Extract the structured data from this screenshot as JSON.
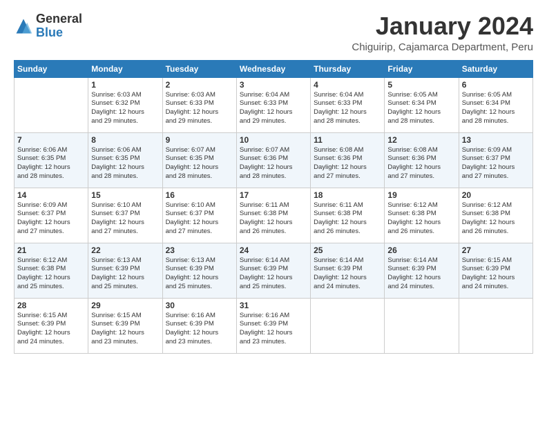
{
  "logo": {
    "general": "General",
    "blue": "Blue"
  },
  "title": "January 2024",
  "location": "Chiguirip, Cajamarca Department, Peru",
  "days_of_week": [
    "Sunday",
    "Monday",
    "Tuesday",
    "Wednesday",
    "Thursday",
    "Friday",
    "Saturday"
  ],
  "weeks": [
    [
      {
        "day": "",
        "info": ""
      },
      {
        "day": "1",
        "info": "Sunrise: 6:03 AM\nSunset: 6:32 PM\nDaylight: 12 hours\nand 29 minutes."
      },
      {
        "day": "2",
        "info": "Sunrise: 6:03 AM\nSunset: 6:33 PM\nDaylight: 12 hours\nand 29 minutes."
      },
      {
        "day": "3",
        "info": "Sunrise: 6:04 AM\nSunset: 6:33 PM\nDaylight: 12 hours\nand 29 minutes."
      },
      {
        "day": "4",
        "info": "Sunrise: 6:04 AM\nSunset: 6:33 PM\nDaylight: 12 hours\nand 28 minutes."
      },
      {
        "day": "5",
        "info": "Sunrise: 6:05 AM\nSunset: 6:34 PM\nDaylight: 12 hours\nand 28 minutes."
      },
      {
        "day": "6",
        "info": "Sunrise: 6:05 AM\nSunset: 6:34 PM\nDaylight: 12 hours\nand 28 minutes."
      }
    ],
    [
      {
        "day": "7",
        "info": "Sunrise: 6:06 AM\nSunset: 6:35 PM\nDaylight: 12 hours\nand 28 minutes."
      },
      {
        "day": "8",
        "info": "Sunrise: 6:06 AM\nSunset: 6:35 PM\nDaylight: 12 hours\nand 28 minutes."
      },
      {
        "day": "9",
        "info": "Sunrise: 6:07 AM\nSunset: 6:35 PM\nDaylight: 12 hours\nand 28 minutes."
      },
      {
        "day": "10",
        "info": "Sunrise: 6:07 AM\nSunset: 6:36 PM\nDaylight: 12 hours\nand 28 minutes."
      },
      {
        "day": "11",
        "info": "Sunrise: 6:08 AM\nSunset: 6:36 PM\nDaylight: 12 hours\nand 27 minutes."
      },
      {
        "day": "12",
        "info": "Sunrise: 6:08 AM\nSunset: 6:36 PM\nDaylight: 12 hours\nand 27 minutes."
      },
      {
        "day": "13",
        "info": "Sunrise: 6:09 AM\nSunset: 6:37 PM\nDaylight: 12 hours\nand 27 minutes."
      }
    ],
    [
      {
        "day": "14",
        "info": "Sunrise: 6:09 AM\nSunset: 6:37 PM\nDaylight: 12 hours\nand 27 minutes."
      },
      {
        "day": "15",
        "info": "Sunrise: 6:10 AM\nSunset: 6:37 PM\nDaylight: 12 hours\nand 27 minutes."
      },
      {
        "day": "16",
        "info": "Sunrise: 6:10 AM\nSunset: 6:37 PM\nDaylight: 12 hours\nand 27 minutes."
      },
      {
        "day": "17",
        "info": "Sunrise: 6:11 AM\nSunset: 6:38 PM\nDaylight: 12 hours\nand 26 minutes."
      },
      {
        "day": "18",
        "info": "Sunrise: 6:11 AM\nSunset: 6:38 PM\nDaylight: 12 hours\nand 26 minutes."
      },
      {
        "day": "19",
        "info": "Sunrise: 6:12 AM\nSunset: 6:38 PM\nDaylight: 12 hours\nand 26 minutes."
      },
      {
        "day": "20",
        "info": "Sunrise: 6:12 AM\nSunset: 6:38 PM\nDaylight: 12 hours\nand 26 minutes."
      }
    ],
    [
      {
        "day": "21",
        "info": "Sunrise: 6:12 AM\nSunset: 6:38 PM\nDaylight: 12 hours\nand 25 minutes."
      },
      {
        "day": "22",
        "info": "Sunrise: 6:13 AM\nSunset: 6:39 PM\nDaylight: 12 hours\nand 25 minutes."
      },
      {
        "day": "23",
        "info": "Sunrise: 6:13 AM\nSunset: 6:39 PM\nDaylight: 12 hours\nand 25 minutes."
      },
      {
        "day": "24",
        "info": "Sunrise: 6:14 AM\nSunset: 6:39 PM\nDaylight: 12 hours\nand 25 minutes."
      },
      {
        "day": "25",
        "info": "Sunrise: 6:14 AM\nSunset: 6:39 PM\nDaylight: 12 hours\nand 24 minutes."
      },
      {
        "day": "26",
        "info": "Sunrise: 6:14 AM\nSunset: 6:39 PM\nDaylight: 12 hours\nand 24 minutes."
      },
      {
        "day": "27",
        "info": "Sunrise: 6:15 AM\nSunset: 6:39 PM\nDaylight: 12 hours\nand 24 minutes."
      }
    ],
    [
      {
        "day": "28",
        "info": "Sunrise: 6:15 AM\nSunset: 6:39 PM\nDaylight: 12 hours\nand 24 minutes."
      },
      {
        "day": "29",
        "info": "Sunrise: 6:15 AM\nSunset: 6:39 PM\nDaylight: 12 hours\nand 23 minutes."
      },
      {
        "day": "30",
        "info": "Sunrise: 6:16 AM\nSunset: 6:39 PM\nDaylight: 12 hours\nand 23 minutes."
      },
      {
        "day": "31",
        "info": "Sunrise: 6:16 AM\nSunset: 6:39 PM\nDaylight: 12 hours\nand 23 minutes."
      },
      {
        "day": "",
        "info": ""
      },
      {
        "day": "",
        "info": ""
      },
      {
        "day": "",
        "info": ""
      }
    ]
  ]
}
